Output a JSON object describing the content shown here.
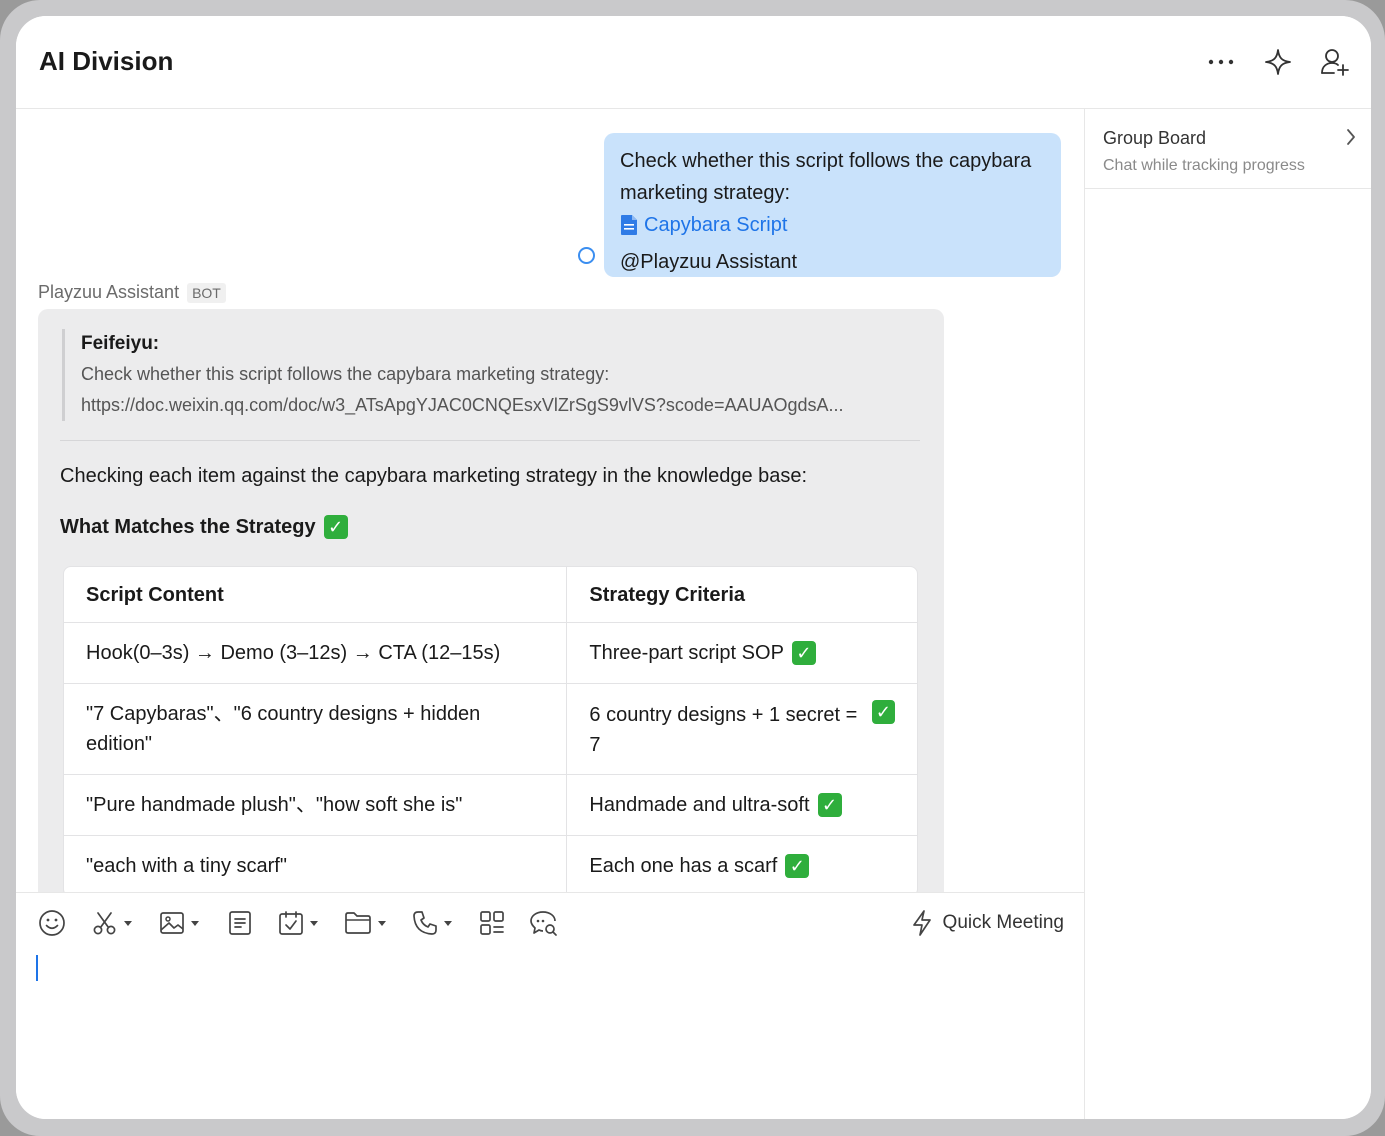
{
  "header": {
    "title": "AI Division"
  },
  "side_panel": {
    "board_title": "Group Board",
    "board_subtitle": "Chat while tracking progress"
  },
  "user_message": {
    "text": "Check whether this script follows the capybara marketing strategy:",
    "doc_title": "Capybara Script",
    "mention": "@Playzuu Assistant"
  },
  "bot_message": {
    "sender": "Playzuu Assistant",
    "badge": "BOT",
    "quote_author": "Feifeiyu:",
    "quote_text": "Check whether this script follows the capybara marketing strategy:",
    "quote_link": "https://doc.weixin.qq.com/doc/w3_ATsApgYJAC0CNQEsxVlZrSgS9vlVS?scode=AAUAOgdsA...",
    "intro": "Checking each item against the capybara marketing strategy in the knowledge base:",
    "section_title": "What Matches the Strategy",
    "table": {
      "headers": [
        "Script Content",
        "Strategy Criteria"
      ],
      "rows": [
        {
          "content": "Hook(0–3s) → Demo (3–12s) → CTA (12–15s)",
          "criteria": "Three-part script SOP"
        },
        {
          "content": "\"7 Capybaras\"、\"6 country designs + hidden edition\"",
          "criteria": "6 country designs + 1 secret = 7"
        },
        {
          "content": "\"Pure handmade plush\"、\"how soft she is\"",
          "criteria": "Handmade and ultra-soft"
        },
        {
          "content": "\"each with a tiny scarf\"",
          "criteria": "Each one has a scarf"
        }
      ]
    }
  },
  "composer": {
    "quick_meeting": "Quick Meeting"
  },
  "colors": {
    "user_bubble": "#c9e2fb",
    "bot_bubble": "#ececed",
    "link": "#1e74e8",
    "check": "#2fae3c"
  }
}
